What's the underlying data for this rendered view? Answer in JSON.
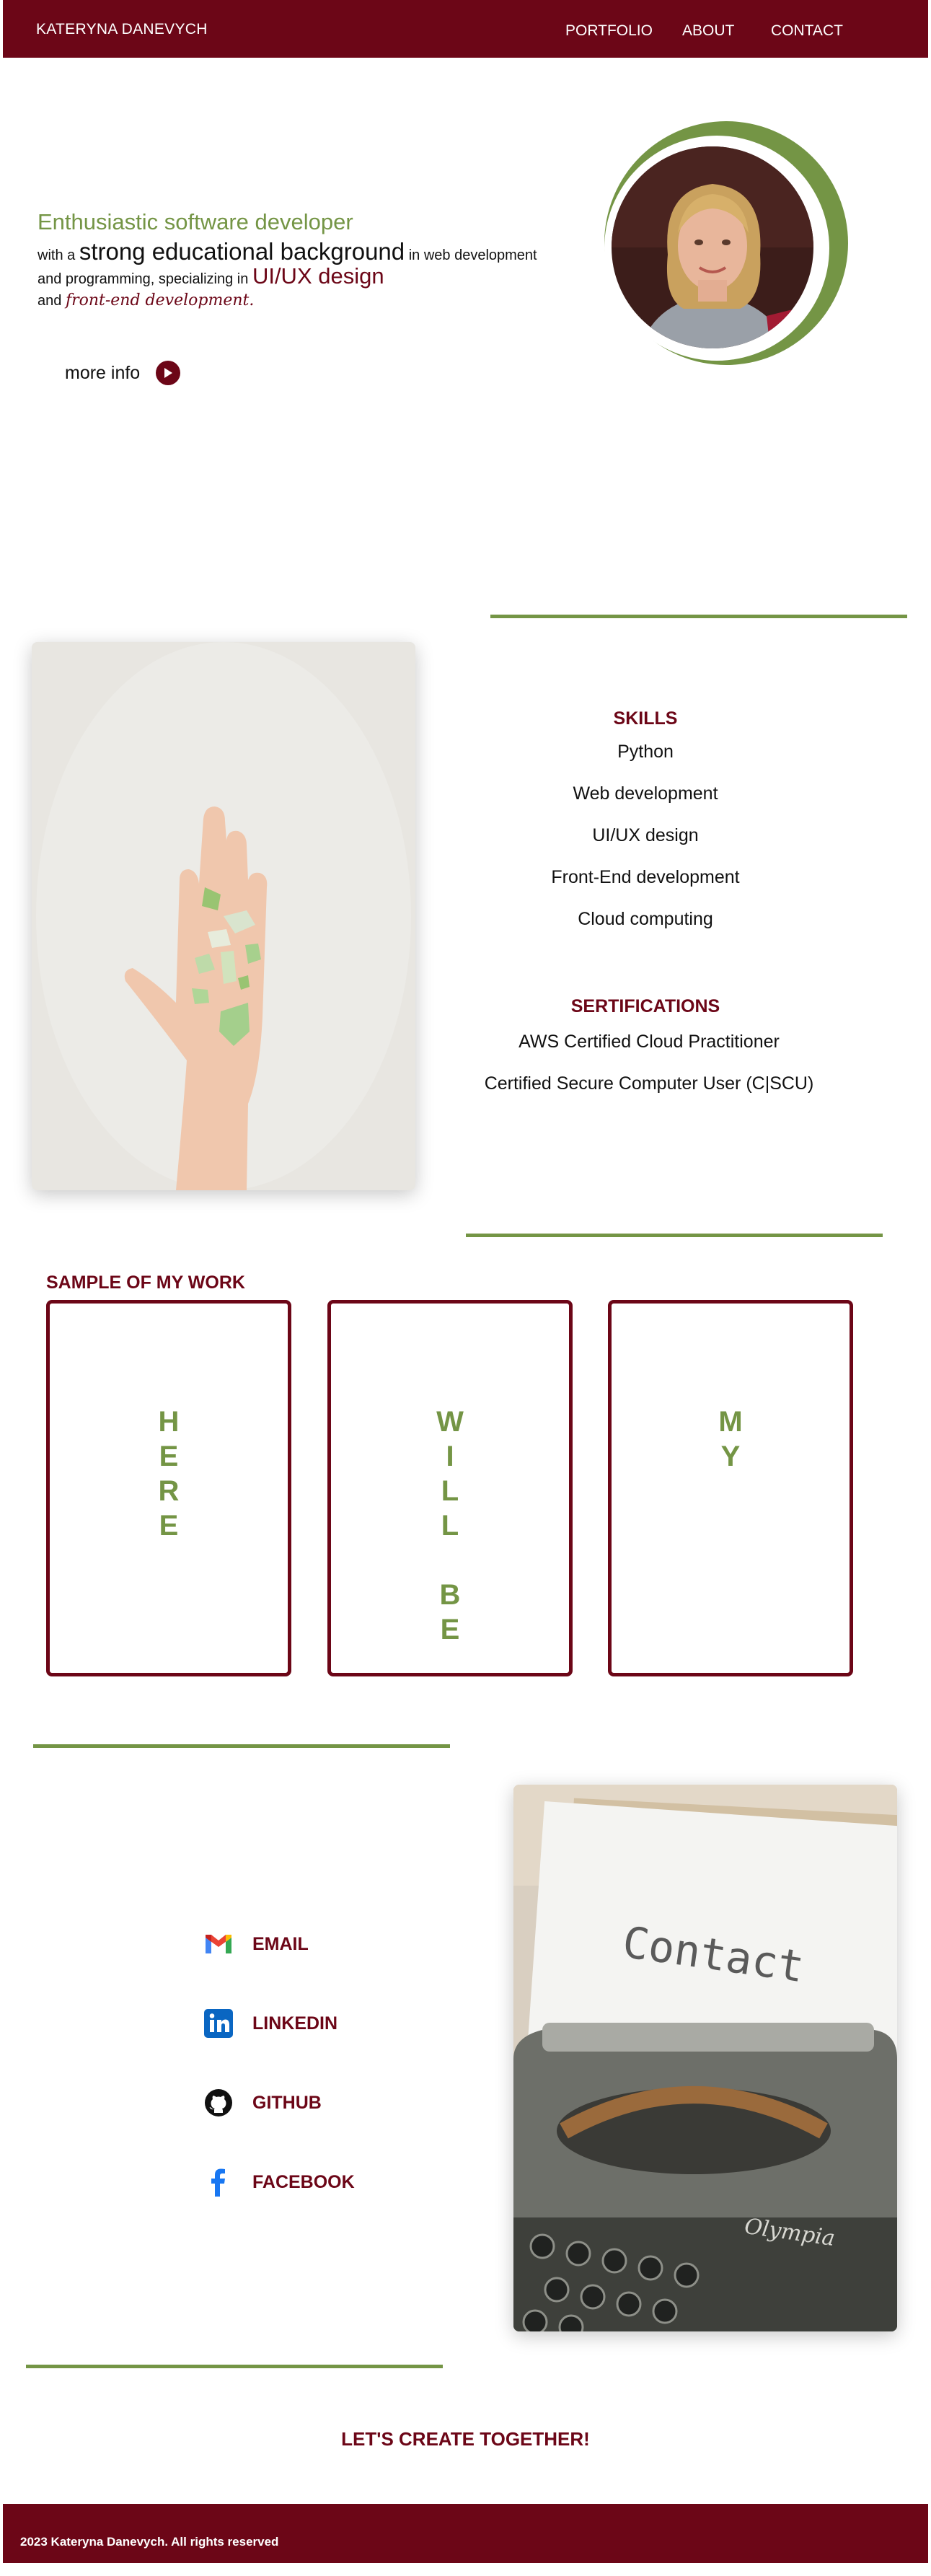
{
  "header": {
    "brand": "KATERYNA DANEVYCH",
    "nav": [
      "PORTFOLIO",
      "ABOUT",
      "CONTACT"
    ]
  },
  "hero": {
    "title": "Enthusiastic software developer",
    "line1_pre": "with a",
    "line1_big": "strong educational background",
    "line1_post": "in web development",
    "line2_pre": "and programming, specializing in",
    "line2_accent": "UI/UX design",
    "line3_pre": "and",
    "line3_script": "front-end development.",
    "more_info": "more info"
  },
  "skills": {
    "heading": "SKILLS",
    "items": [
      "Python",
      "Web development",
      "UI/UX design",
      "Front-End development",
      "Cloud computing"
    ]
  },
  "certifications": {
    "heading": "SERTIFICATIONS",
    "items": [
      "AWS Certified Cloud Practitioner",
      "Certified Secure Computer User (C|SCU)"
    ]
  },
  "work": {
    "heading": "SAMPLE OF MY WORK",
    "cards": [
      {
        "letters": [
          "H",
          "E",
          "R",
          "E"
        ]
      },
      {
        "letters": [
          "W",
          "I",
          "L",
          "L",
          "",
          "B",
          "E"
        ]
      },
      {
        "letters": [
          "M",
          "Y"
        ]
      }
    ]
  },
  "contact": {
    "items": [
      {
        "label": "EMAIL",
        "icon": "gmail-icon"
      },
      {
        "label": "LINKEDIN",
        "icon": "linkedin-icon"
      },
      {
        "label": "GITHUB",
        "icon": "github-icon"
      },
      {
        "label": "FACEBOOK",
        "icon": "facebook-icon"
      }
    ],
    "image_text": "Contact",
    "cta": "LET'S CREATE TOGETHER!"
  },
  "footer": {
    "text": "2023 Kateryna Danevych.  All rights reserved"
  },
  "colors": {
    "brand": "#6c0617",
    "accent": "#749545",
    "background": "#ffffff"
  }
}
